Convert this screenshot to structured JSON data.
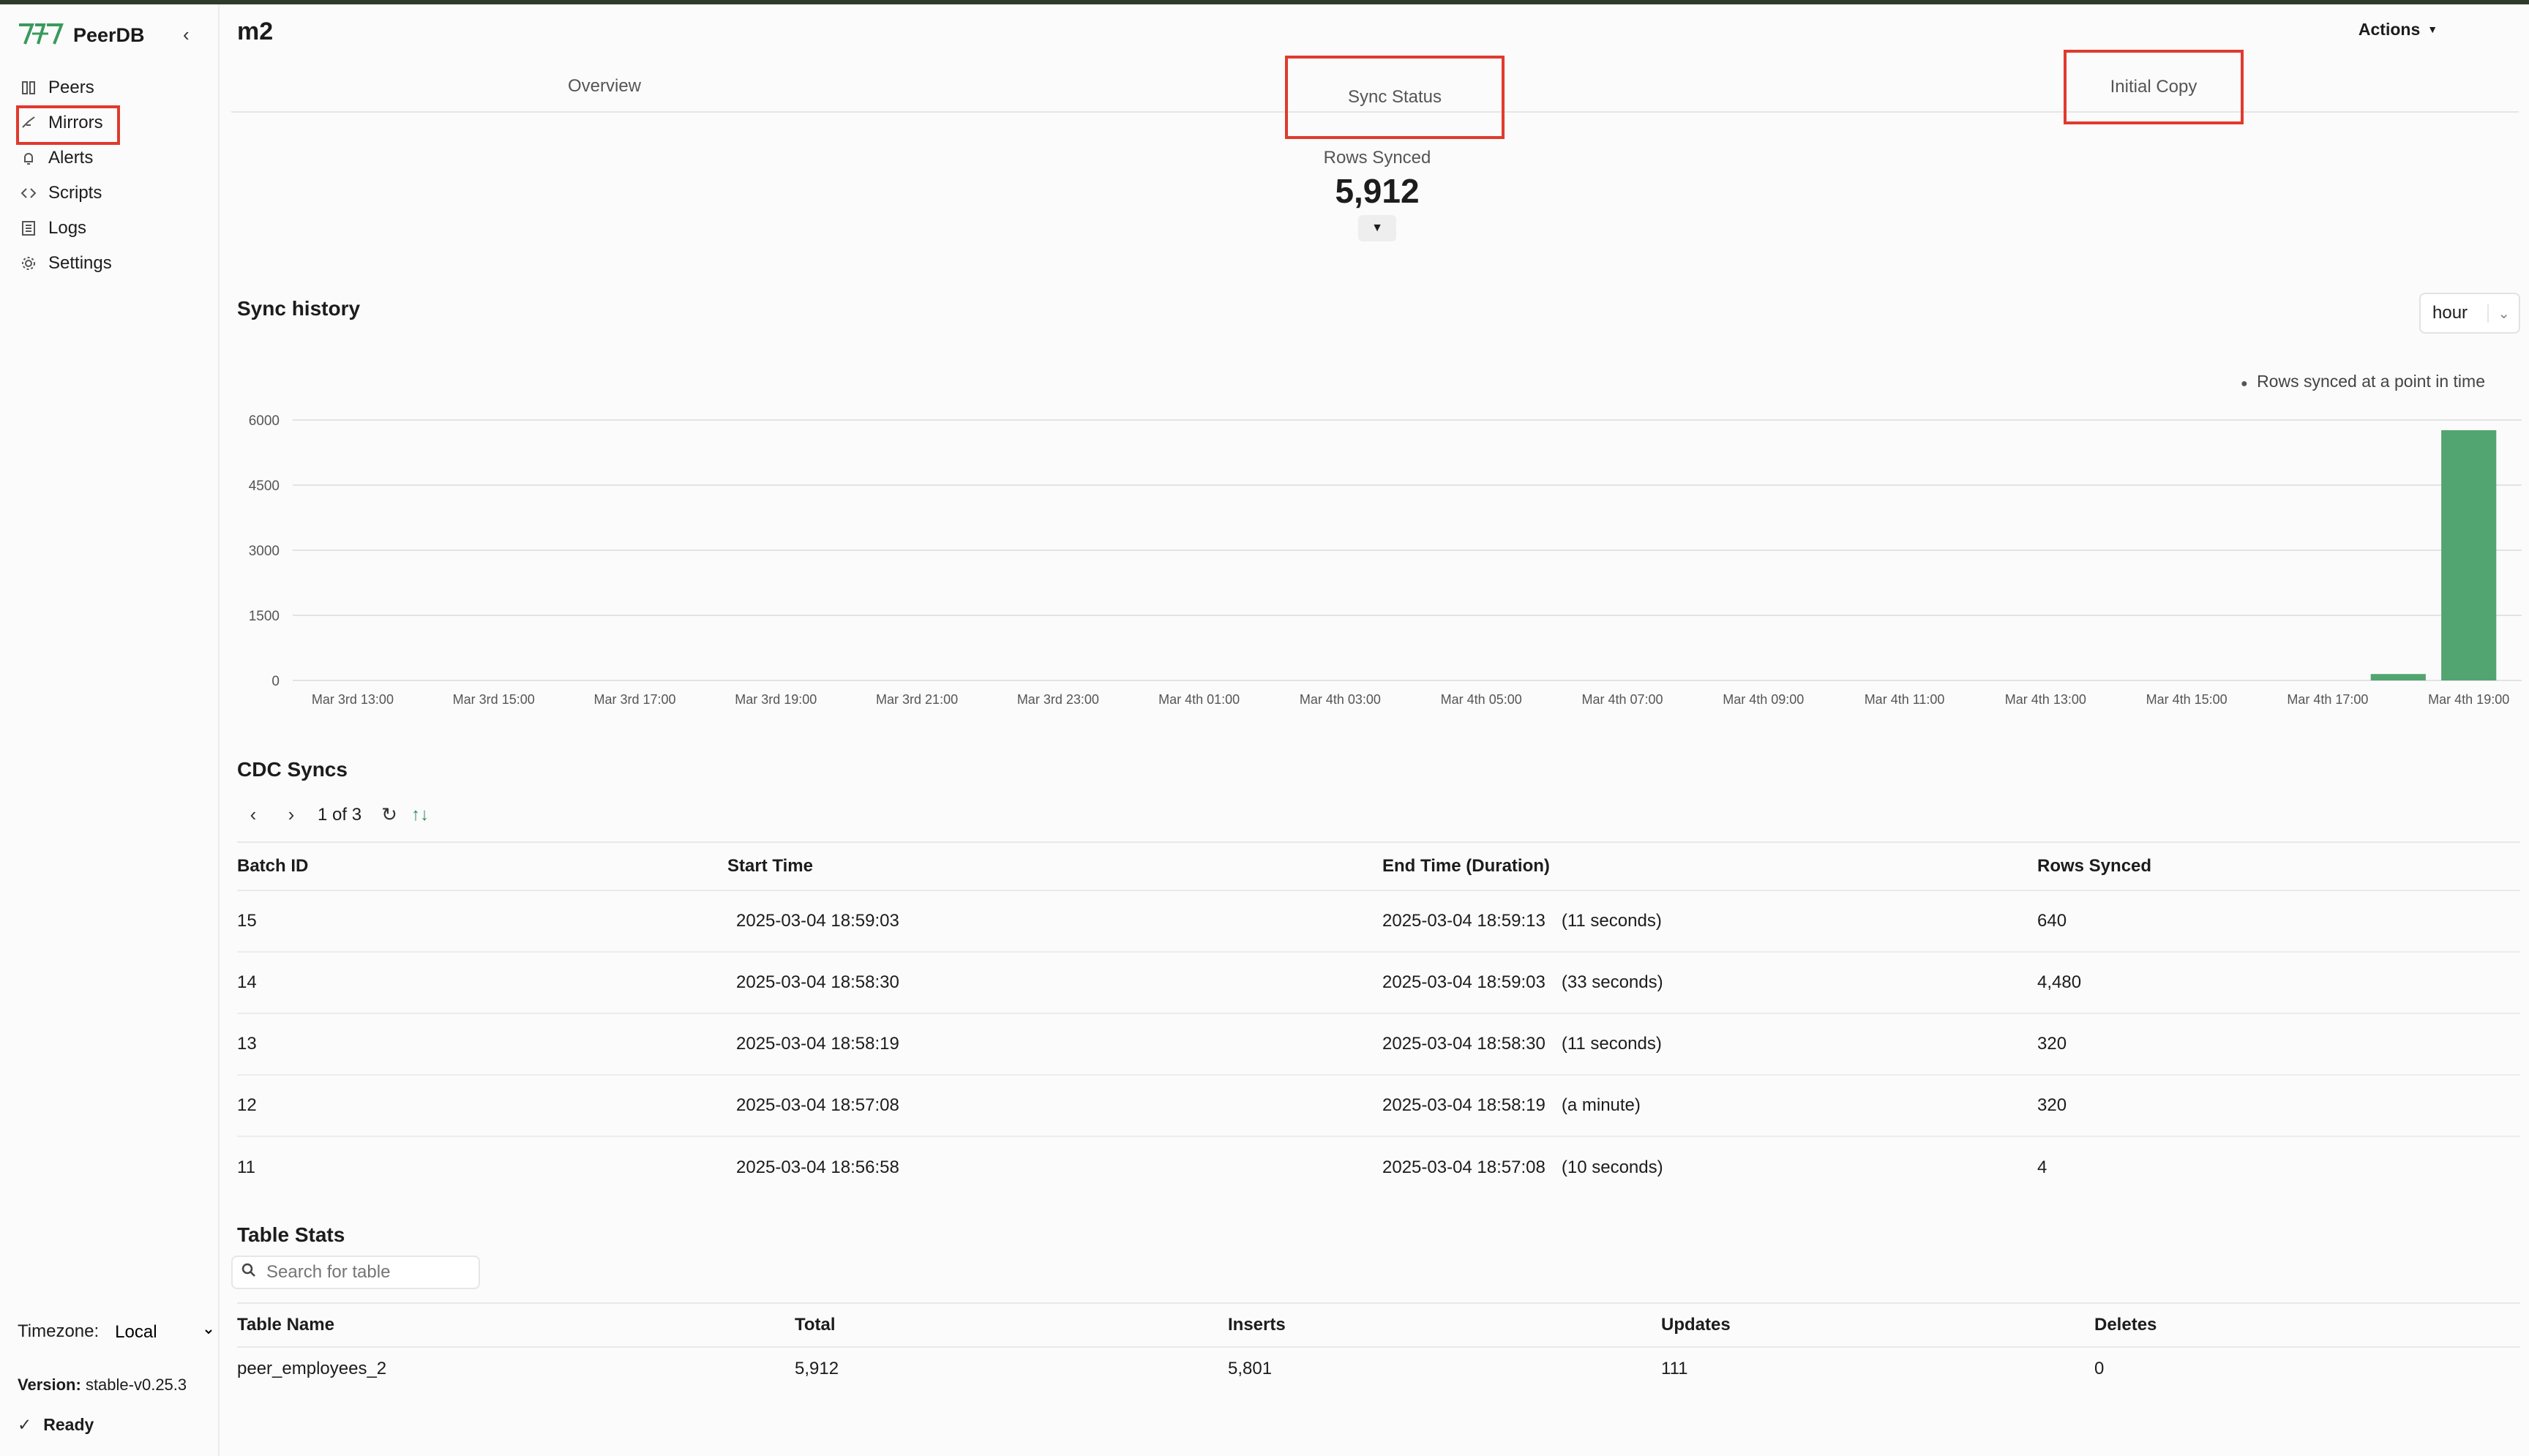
{
  "app": {
    "name": "PeerDB"
  },
  "sidebar": {
    "items": [
      {
        "label": "Peers",
        "icon": "peers-icon"
      },
      {
        "label": "Mirrors",
        "icon": "mirrors-icon"
      },
      {
        "label": "Alerts",
        "icon": "bell-icon"
      },
      {
        "label": "Scripts",
        "icon": "code-icon"
      },
      {
        "label": "Logs",
        "icon": "logs-icon"
      },
      {
        "label": "Settings",
        "icon": "gear-icon"
      }
    ],
    "timezone_label": "Timezone:",
    "timezone_value": "Local",
    "version_label": "Version:",
    "version_value": "stable-v0.25.3",
    "status": "Ready"
  },
  "header": {
    "title": "m2",
    "actions_label": "Actions"
  },
  "tabs": [
    "Overview",
    "Sync Status",
    "Initial Copy"
  ],
  "rows_synced": {
    "label": "Rows Synced",
    "value": "5,912"
  },
  "sync_history": {
    "title": "Sync history",
    "interval": "hour",
    "legend": "Rows synced at a point in time"
  },
  "chart_data": {
    "type": "bar",
    "title": "Sync history",
    "xlabel": "",
    "ylabel": "",
    "ylim": [
      0,
      6000
    ],
    "y_ticks": [
      "6000",
      "4500",
      "3000",
      "1500",
      "0"
    ],
    "x_ticks": [
      "Mar 3rd 13:00",
      "Mar 3rd 15:00",
      "Mar 3rd 17:00",
      "Mar 3rd 19:00",
      "Mar 3rd 21:00",
      "Mar 3rd 23:00",
      "Mar 4th 01:00",
      "Mar 4th 03:00",
      "Mar 4th 05:00",
      "Mar 4th 07:00",
      "Mar 4th 09:00",
      "Mar 4th 11:00",
      "Mar 4th 13:00",
      "Mar 4th 15:00",
      "Mar 4th 17:00",
      "Mar 4th 19:00"
    ],
    "categories": [
      "Mar 3rd 13:00",
      "Mar 3rd 14:00",
      "Mar 3rd 15:00",
      "Mar 3rd 16:00",
      "Mar 3rd 17:00",
      "Mar 3rd 18:00",
      "Mar 3rd 19:00",
      "Mar 3rd 20:00",
      "Mar 3rd 21:00",
      "Mar 3rd 22:00",
      "Mar 3rd 23:00",
      "Mar 4th 00:00",
      "Mar 4th 01:00",
      "Mar 4th 02:00",
      "Mar 4th 03:00",
      "Mar 4th 04:00",
      "Mar 4th 05:00",
      "Mar 4th 06:00",
      "Mar 4th 07:00",
      "Mar 4th 08:00",
      "Mar 4th 09:00",
      "Mar 4th 10:00",
      "Mar 4th 11:00",
      "Mar 4th 12:00",
      "Mar 4th 13:00",
      "Mar 4th 14:00",
      "Mar 4th 15:00",
      "Mar 4th 16:00",
      "Mar 4th 17:00",
      "Mar 4th 18:00",
      "Mar 4th 19:00"
    ],
    "values": [
      0,
      0,
      0,
      0,
      0,
      0,
      0,
      0,
      0,
      0,
      0,
      0,
      0,
      0,
      0,
      0,
      0,
      0,
      0,
      0,
      0,
      0,
      0,
      0,
      0,
      0,
      0,
      0,
      0,
      148,
      5764
    ],
    "grid": true,
    "legend_position": "top-right",
    "color": "#52a570"
  },
  "cdc": {
    "title": "CDC Syncs",
    "page_text": "1 of 3",
    "columns": [
      "Batch ID",
      "Start Time",
      "End Time (Duration)",
      "Rows Synced"
    ],
    "rows": [
      {
        "batch": "15",
        "start": "2025-03-04 18:59:03",
        "end": "2025-03-04 18:59:13",
        "duration": "(11 seconds)",
        "rows": "640"
      },
      {
        "batch": "14",
        "start": "2025-03-04 18:58:30",
        "end": "2025-03-04 18:59:03",
        "duration": "(33 seconds)",
        "rows": "4,480"
      },
      {
        "batch": "13",
        "start": "2025-03-04 18:58:19",
        "end": "2025-03-04 18:58:30",
        "duration": "(11 seconds)",
        "rows": "320"
      },
      {
        "batch": "12",
        "start": "2025-03-04 18:57:08",
        "end": "2025-03-04 18:58:19",
        "duration": "(a minute)",
        "rows": "320"
      },
      {
        "batch": "11",
        "start": "2025-03-04 18:56:58",
        "end": "2025-03-04 18:57:08",
        "duration": "(10 seconds)",
        "rows": "4"
      }
    ]
  },
  "table_stats": {
    "title": "Table Stats",
    "search_placeholder": "Search for table",
    "columns": [
      "Table Name",
      "Total",
      "Inserts",
      "Updates",
      "Deletes"
    ],
    "rows": [
      {
        "name": "peer_employees_2",
        "total": "5,912",
        "inserts": "5,801",
        "updates": "111",
        "deletes": "0"
      }
    ]
  }
}
